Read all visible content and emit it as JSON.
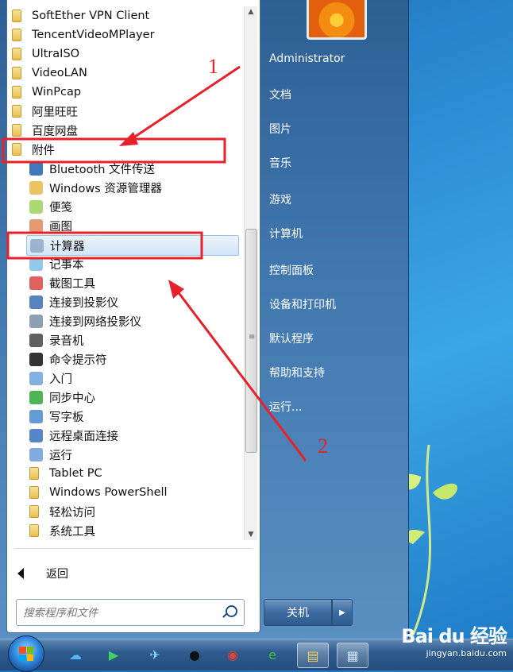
{
  "programs": [
    {
      "label": "SoftEther VPN Client",
      "icon": "folder-icon",
      "type": "folder"
    },
    {
      "label": "TencentVideoMPlayer",
      "icon": "folder-icon",
      "type": "folder"
    },
    {
      "label": "UltraISO",
      "icon": "folder-icon",
      "type": "folder"
    },
    {
      "label": "VideoLAN",
      "icon": "folder-icon",
      "type": "folder"
    },
    {
      "label": "WinPcap",
      "icon": "folder-icon",
      "type": "folder"
    },
    {
      "label": "阿里旺旺",
      "icon": "folder-icon",
      "type": "folder"
    },
    {
      "label": "百度网盘",
      "icon": "folder-icon",
      "type": "folder"
    },
    {
      "label": "附件",
      "icon": "folder-icon",
      "type": "folder"
    },
    {
      "label": "Bluetooth 文件传送",
      "icon": "bluetooth-icon",
      "type": "sub"
    },
    {
      "label": "Windows 资源管理器",
      "icon": "explorer-icon",
      "type": "sub"
    },
    {
      "label": "便笺",
      "icon": "sticky-notes-icon",
      "type": "sub"
    },
    {
      "label": "画图",
      "icon": "paint-icon",
      "type": "sub"
    },
    {
      "label": "计算器",
      "icon": "calculator-icon",
      "type": "sub",
      "selected": true
    },
    {
      "label": "记事本",
      "icon": "notepad-icon",
      "type": "sub"
    },
    {
      "label": "截图工具",
      "icon": "snipping-tool-icon",
      "type": "sub"
    },
    {
      "label": "连接到投影仪",
      "icon": "projector-icon",
      "type": "sub"
    },
    {
      "label": "连接到网络投影仪",
      "icon": "network-projector-icon",
      "type": "sub"
    },
    {
      "label": "录音机",
      "icon": "microphone-icon",
      "type": "sub"
    },
    {
      "label": "命令提示符",
      "icon": "cmd-icon",
      "type": "sub"
    },
    {
      "label": "入门",
      "icon": "getting-started-icon",
      "type": "sub"
    },
    {
      "label": "同步中心",
      "icon": "sync-center-icon",
      "type": "sub"
    },
    {
      "label": "写字板",
      "icon": "wordpad-icon",
      "type": "sub"
    },
    {
      "label": "远程桌面连接",
      "icon": "remote-desktop-icon",
      "type": "sub"
    },
    {
      "label": "运行",
      "icon": "run-icon",
      "type": "sub"
    },
    {
      "label": "Tablet PC",
      "icon": "folder-icon",
      "type": "subfolder"
    },
    {
      "label": "Windows PowerShell",
      "icon": "folder-icon",
      "type": "subfolder"
    },
    {
      "label": "轻松访问",
      "icon": "folder-icon",
      "type": "subfolder"
    },
    {
      "label": "系统工具",
      "icon": "folder-icon",
      "type": "subfolder"
    }
  ],
  "back_label": "返回",
  "search": {
    "placeholder": "搜索程序和文件"
  },
  "right_pane": {
    "items": [
      "Administrator",
      "文档",
      "图片",
      "音乐",
      "游戏",
      "计算机",
      "控制面板",
      "设备和打印机",
      "默认程序",
      "帮助和支持",
      "运行..."
    ]
  },
  "shutdown_label": "关机",
  "annotations": {
    "label_1": "1",
    "label_2": "2",
    "color": "#e8202a"
  },
  "taskbar": {
    "items": [
      "start-button",
      "baidu-netdisk-icon",
      "video-player-icon",
      "feishu-icon",
      "qq-icon",
      "chrome-icon",
      "ie-icon",
      "explorer-icon",
      "calculator-icon"
    ]
  },
  "watermark": {
    "main": "Bai du 经验",
    "sub": "jingyan.baidu.com"
  }
}
